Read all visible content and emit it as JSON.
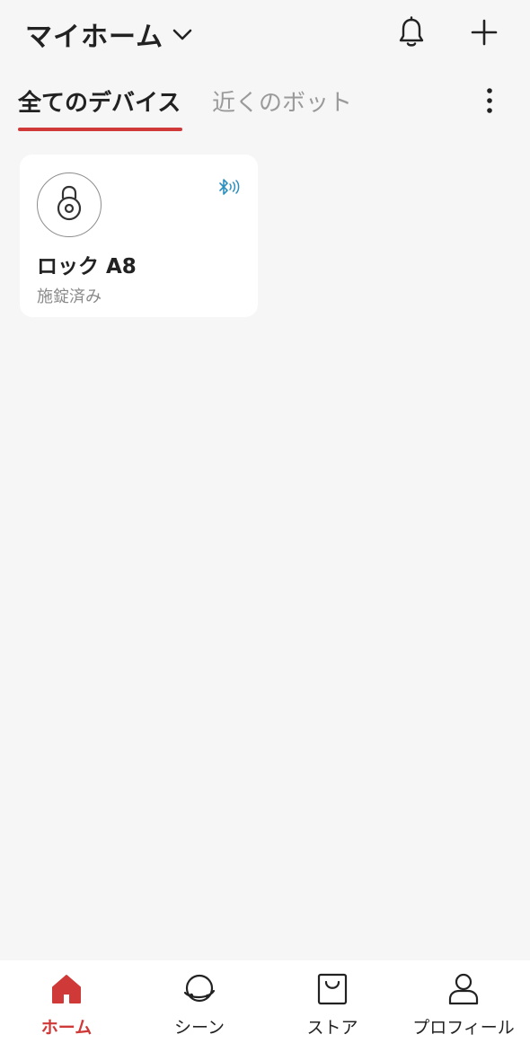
{
  "header": {
    "home_title": "マイホーム",
    "chevron_icon": "chevron-down-icon",
    "notification_icon": "bell-icon",
    "add_icon": "plus-icon"
  },
  "tabs": [
    {
      "label": "全てのデバイス",
      "active": true
    },
    {
      "label": "近くのボット",
      "active": false
    }
  ],
  "more_icon": "more-vertical-icon",
  "devices": [
    {
      "name": "ロック A8",
      "status": "施錠済み",
      "icon": "lock-icon",
      "connection_icon": "bluetooth-icon"
    }
  ],
  "bottom_nav": [
    {
      "label": "ホーム",
      "icon": "home-icon",
      "active": true
    },
    {
      "label": "シーン",
      "icon": "scene-icon",
      "active": false
    },
    {
      "label": "ストア",
      "icon": "shopping-bag-icon",
      "active": false
    },
    {
      "label": "プロフィール",
      "icon": "user-icon",
      "active": false
    }
  ],
  "colors": {
    "accent": "#cf3a38",
    "background": "#f6f6f6",
    "card": "#ffffff",
    "bluetooth": "#2b8fc0",
    "muted_text": "#9a9a9a"
  }
}
